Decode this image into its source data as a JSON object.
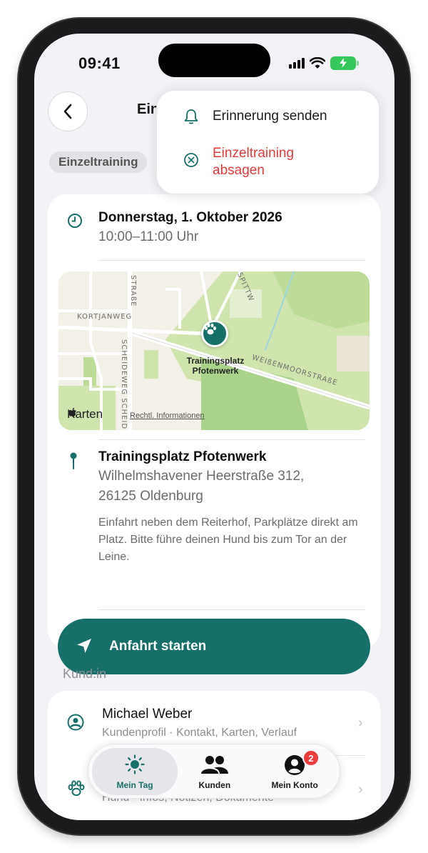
{
  "status_bar": {
    "time": "09:41"
  },
  "header": {
    "title": "Ein",
    "chip": "Einzeltraining"
  },
  "context_menu": {
    "reminder_label": "Erinnerung senden",
    "cancel_label": "Einzeltraining absagen"
  },
  "appointment": {
    "date": "Donnerstag, 1. Oktober 2026",
    "time": "10:00–11:00 Uhr"
  },
  "map": {
    "pin_label": "Trainingsplatz Pfotenwerk",
    "brand": "Karten",
    "legal": "Rechtl. Informationen",
    "streets": [
      "KORTJANWEG",
      "SCHEIDEWEG",
      "SCHEID",
      "STRASSE",
      "WEISSENMOORSTRASSE",
      "SPITTW"
    ],
    "street_labels": {
      "kortjan": "KORTJANWEG",
      "scheide": "SCHEIDEWEG  SCHEID",
      "strasse": "STRAßE",
      "weissen": "WEIßENMOORSTRAßE",
      "spitt": "SPITTW"
    }
  },
  "location": {
    "name": "Trainingsplatz Pfotenwerk",
    "address_line1": "Wilhelmshavener Heerstraße 312,",
    "address_line2": "26125 Oldenburg",
    "note": "Einfahrt neben dem Reiterhof, Parkplätze direkt am Platz. Bitte führe deinen Hund bis zum Tor an der Leine."
  },
  "cta": {
    "label": "Anfahrt starten"
  },
  "customer_section": {
    "title": "Kund:in",
    "customer_name": "Michael Weber",
    "customer_sub": "Kundenprofil · Kontakt, Karten, Verlauf",
    "dog_sub": "Hund · Infos, Notizen, Dokumente"
  },
  "tab_bar": {
    "tabs": [
      {
        "label": "Mein Tag",
        "active": true
      },
      {
        "label": "Kunden",
        "active": false
      },
      {
        "label": "Mein Konto",
        "active": false,
        "badge": "2"
      }
    ]
  },
  "colors": {
    "accent": "#166f68",
    "destructive": "#e23b3b",
    "background": "#f2f2f7"
  }
}
